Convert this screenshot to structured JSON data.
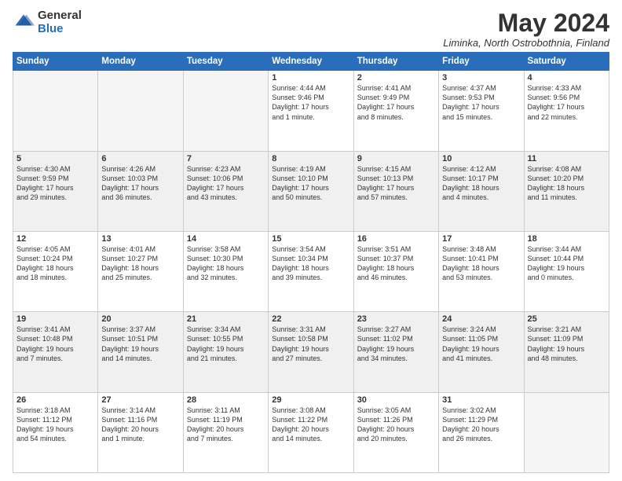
{
  "logo": {
    "general": "General",
    "blue": "Blue"
  },
  "title": "May 2024",
  "location": "Liminka, North Ostrobothnia, Finland",
  "days_header": [
    "Sunday",
    "Monday",
    "Tuesday",
    "Wednesday",
    "Thursday",
    "Friday",
    "Saturday"
  ],
  "weeks": [
    [
      {
        "day": "",
        "info": ""
      },
      {
        "day": "",
        "info": ""
      },
      {
        "day": "",
        "info": ""
      },
      {
        "day": "1",
        "info": "Sunrise: 4:44 AM\nSunset: 9:46 PM\nDaylight: 17 hours\nand 1 minute."
      },
      {
        "day": "2",
        "info": "Sunrise: 4:41 AM\nSunset: 9:49 PM\nDaylight: 17 hours\nand 8 minutes."
      },
      {
        "day": "3",
        "info": "Sunrise: 4:37 AM\nSunset: 9:53 PM\nDaylight: 17 hours\nand 15 minutes."
      },
      {
        "day": "4",
        "info": "Sunrise: 4:33 AM\nSunset: 9:56 PM\nDaylight: 17 hours\nand 22 minutes."
      }
    ],
    [
      {
        "day": "5",
        "info": "Sunrise: 4:30 AM\nSunset: 9:59 PM\nDaylight: 17 hours\nand 29 minutes."
      },
      {
        "day": "6",
        "info": "Sunrise: 4:26 AM\nSunset: 10:03 PM\nDaylight: 17 hours\nand 36 minutes."
      },
      {
        "day": "7",
        "info": "Sunrise: 4:23 AM\nSunset: 10:06 PM\nDaylight: 17 hours\nand 43 minutes."
      },
      {
        "day": "8",
        "info": "Sunrise: 4:19 AM\nSunset: 10:10 PM\nDaylight: 17 hours\nand 50 minutes."
      },
      {
        "day": "9",
        "info": "Sunrise: 4:15 AM\nSunset: 10:13 PM\nDaylight: 17 hours\nand 57 minutes."
      },
      {
        "day": "10",
        "info": "Sunrise: 4:12 AM\nSunset: 10:17 PM\nDaylight: 18 hours\nand 4 minutes."
      },
      {
        "day": "11",
        "info": "Sunrise: 4:08 AM\nSunset: 10:20 PM\nDaylight: 18 hours\nand 11 minutes."
      }
    ],
    [
      {
        "day": "12",
        "info": "Sunrise: 4:05 AM\nSunset: 10:24 PM\nDaylight: 18 hours\nand 18 minutes."
      },
      {
        "day": "13",
        "info": "Sunrise: 4:01 AM\nSunset: 10:27 PM\nDaylight: 18 hours\nand 25 minutes."
      },
      {
        "day": "14",
        "info": "Sunrise: 3:58 AM\nSunset: 10:30 PM\nDaylight: 18 hours\nand 32 minutes."
      },
      {
        "day": "15",
        "info": "Sunrise: 3:54 AM\nSunset: 10:34 PM\nDaylight: 18 hours\nand 39 minutes."
      },
      {
        "day": "16",
        "info": "Sunrise: 3:51 AM\nSunset: 10:37 PM\nDaylight: 18 hours\nand 46 minutes."
      },
      {
        "day": "17",
        "info": "Sunrise: 3:48 AM\nSunset: 10:41 PM\nDaylight: 18 hours\nand 53 minutes."
      },
      {
        "day": "18",
        "info": "Sunrise: 3:44 AM\nSunset: 10:44 PM\nDaylight: 19 hours\nand 0 minutes."
      }
    ],
    [
      {
        "day": "19",
        "info": "Sunrise: 3:41 AM\nSunset: 10:48 PM\nDaylight: 19 hours\nand 7 minutes."
      },
      {
        "day": "20",
        "info": "Sunrise: 3:37 AM\nSunset: 10:51 PM\nDaylight: 19 hours\nand 14 minutes."
      },
      {
        "day": "21",
        "info": "Sunrise: 3:34 AM\nSunset: 10:55 PM\nDaylight: 19 hours\nand 21 minutes."
      },
      {
        "day": "22",
        "info": "Sunrise: 3:31 AM\nSunset: 10:58 PM\nDaylight: 19 hours\nand 27 minutes."
      },
      {
        "day": "23",
        "info": "Sunrise: 3:27 AM\nSunset: 11:02 PM\nDaylight: 19 hours\nand 34 minutes."
      },
      {
        "day": "24",
        "info": "Sunrise: 3:24 AM\nSunset: 11:05 PM\nDaylight: 19 hours\nand 41 minutes."
      },
      {
        "day": "25",
        "info": "Sunrise: 3:21 AM\nSunset: 11:09 PM\nDaylight: 19 hours\nand 48 minutes."
      }
    ],
    [
      {
        "day": "26",
        "info": "Sunrise: 3:18 AM\nSunset: 11:12 PM\nDaylight: 19 hours\nand 54 minutes."
      },
      {
        "day": "27",
        "info": "Sunrise: 3:14 AM\nSunset: 11:16 PM\nDaylight: 20 hours\nand 1 minute."
      },
      {
        "day": "28",
        "info": "Sunrise: 3:11 AM\nSunset: 11:19 PM\nDaylight: 20 hours\nand 7 minutes."
      },
      {
        "day": "29",
        "info": "Sunrise: 3:08 AM\nSunset: 11:22 PM\nDaylight: 20 hours\nand 14 minutes."
      },
      {
        "day": "30",
        "info": "Sunrise: 3:05 AM\nSunset: 11:26 PM\nDaylight: 20 hours\nand 20 minutes."
      },
      {
        "day": "31",
        "info": "Sunrise: 3:02 AM\nSunset: 11:29 PM\nDaylight: 20 hours\nand 26 minutes."
      },
      {
        "day": "",
        "info": ""
      }
    ]
  ]
}
